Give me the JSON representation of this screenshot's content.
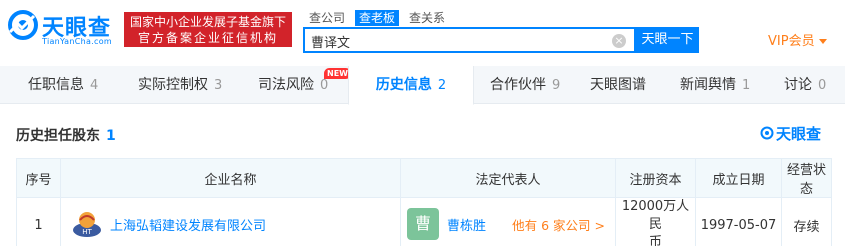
{
  "brand": {
    "name": "天眼查",
    "domain": "TianYanCha.com"
  },
  "banner": {
    "line1": "国家中小企业发展子基金旗下",
    "line2": "官方备案企业征信机构"
  },
  "search": {
    "tabs": [
      "查公司",
      "查老板",
      "查关系"
    ],
    "active_tab": 1,
    "value": "曹译文",
    "button_label": "天眼一下"
  },
  "vip": {
    "label": "VIP会员"
  },
  "nav": {
    "tabs": [
      {
        "label": "任职信息",
        "count": "4"
      },
      {
        "label": "实际控制权",
        "count": "3"
      },
      {
        "label": "司法风险",
        "count": "0",
        "badge": "NEW"
      },
      {
        "label": "历史信息",
        "count": "2"
      },
      {
        "label": "合作伙伴",
        "count": "9"
      },
      {
        "label": "天眼图谱",
        "count": ""
      },
      {
        "label": "新闻舆情",
        "count": "1"
      },
      {
        "label": "讨论",
        "count": "0"
      }
    ]
  },
  "section": {
    "title": "历史担任股东",
    "count": "1",
    "watermark": "天眼查"
  },
  "table": {
    "headers": [
      "序号",
      "企业名称",
      "法定代表人",
      "注册资本",
      "成立日期",
      "经营状态"
    ],
    "rows": [
      {
        "index": "1",
        "company": "上海弘韬建设发展有限公司",
        "rep_avatar": "曹",
        "rep_name": "曹栋胜",
        "rep_more": "他有 6 家公司 >",
        "capital_line1": "12000万人民",
        "capital_line2": "币",
        "founded": "1997-05-07",
        "status": "存续"
      }
    ]
  },
  "colors": {
    "brand_blue": "#0084ff",
    "banner_red": "#d2232a",
    "vip_orange": "#ff7f1b",
    "status_green": "#22a45d",
    "avatar_green": "#7cc49a"
  }
}
